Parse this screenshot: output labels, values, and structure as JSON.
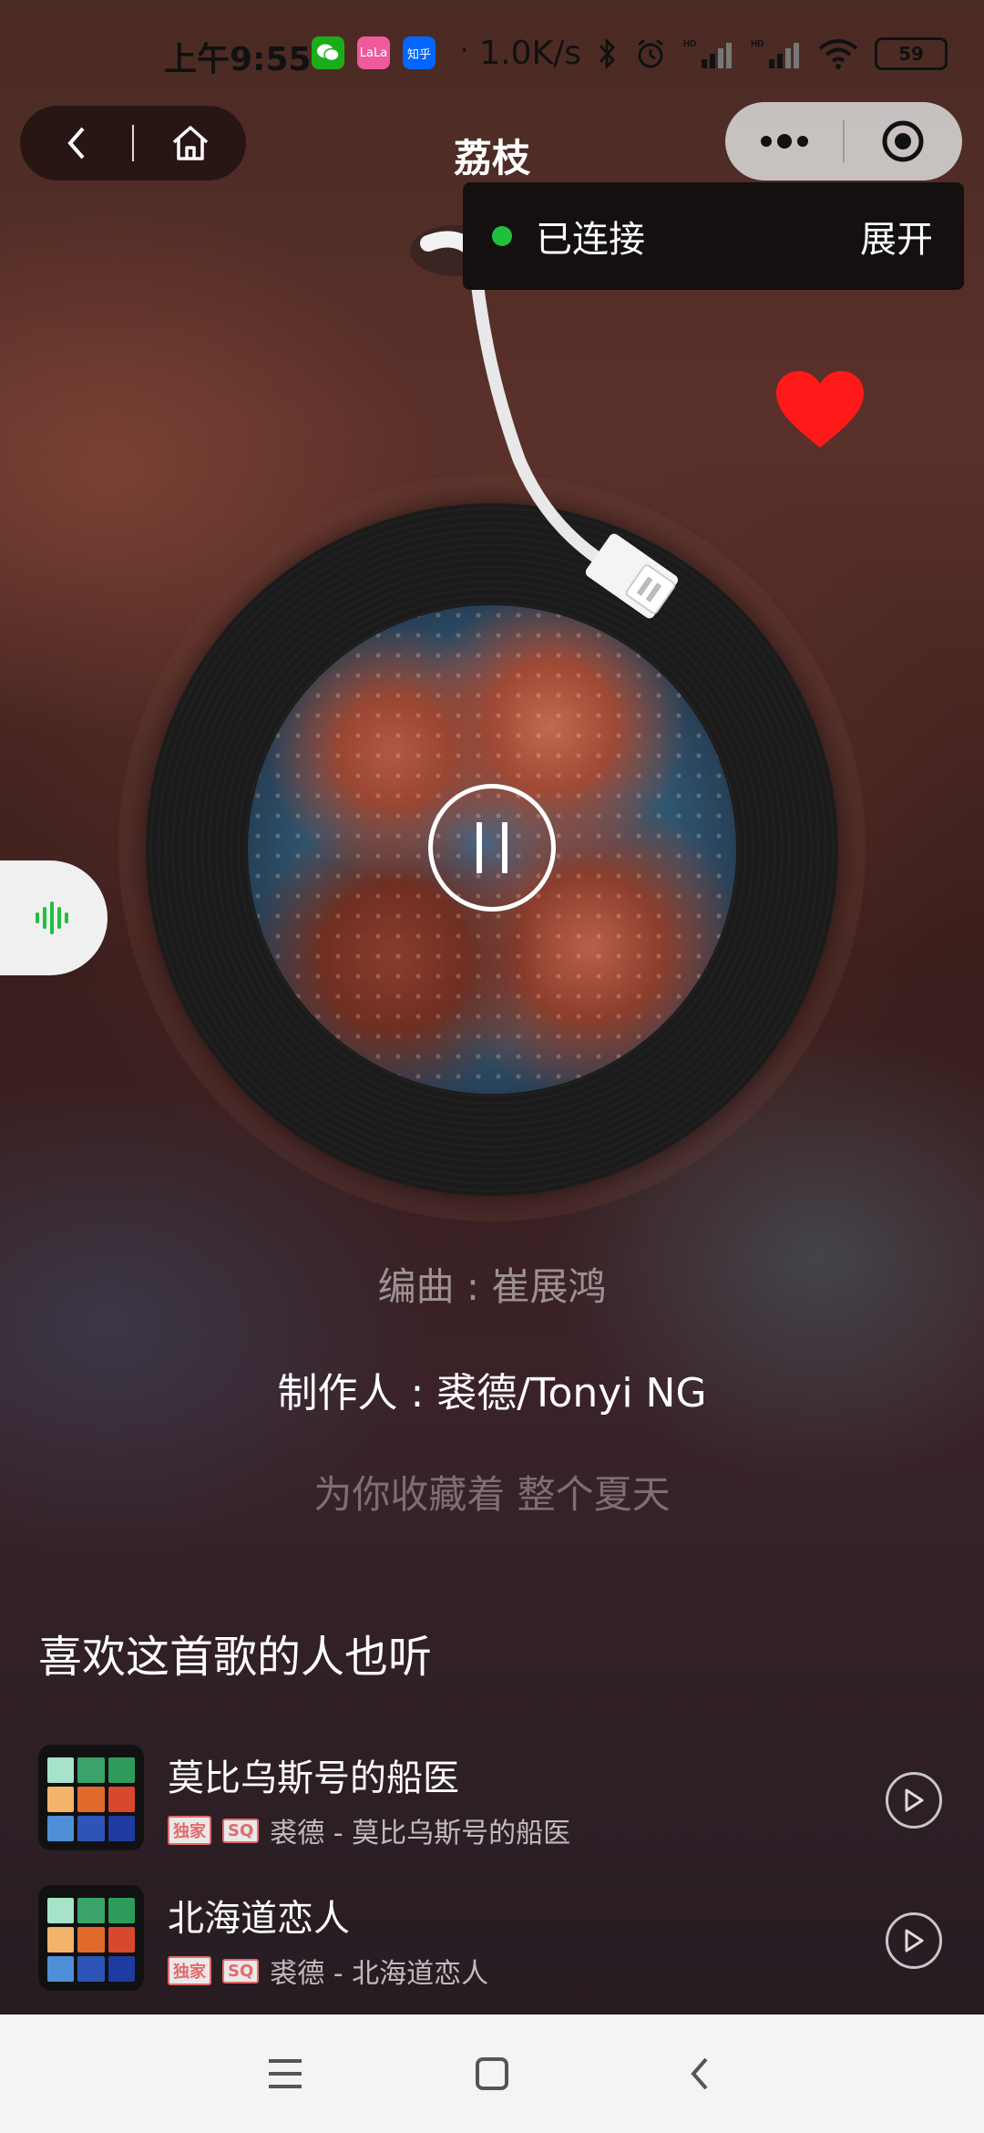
{
  "status_bar": {
    "time": "上午9:55",
    "badges": [
      {
        "name": "wechat-app-icon",
        "label": "",
        "color": "#1aad19"
      },
      {
        "name": "lalala-app-icon",
        "label": "LaLa",
        "color": "#ef5a9b"
      },
      {
        "name": "zhihu-app-icon",
        "label": "知乎",
        "color": "#0066ff"
      }
    ],
    "separator": "·",
    "network_speed": "1.0K/s",
    "battery": "59"
  },
  "header": {
    "title": "荔枝"
  },
  "connection": {
    "status": "已连接",
    "expand_label": "展开",
    "status_color": "#1fbf3f"
  },
  "player": {
    "favorited": true,
    "playing": true,
    "heart_color": "#ff1a1a"
  },
  "lyrics": {
    "previous": "编曲 : 崔展鸿",
    "current": "制作人 : 裘德/Tonyi NG",
    "next": "为你收藏着 整个夏天"
  },
  "recommendations": {
    "title": "喜欢这首歌的人也听",
    "songs": [
      {
        "title": "莫比乌斯号的船医",
        "tag_exclusive": "独家",
        "tag_quality": "SQ",
        "subtitle": "裘德 - 莫比乌斯号的船医"
      },
      {
        "title": "北海道恋人",
        "tag_exclusive": "独家",
        "tag_quality": "SQ",
        "subtitle": "裘德 - 北海道恋人"
      }
    ]
  }
}
